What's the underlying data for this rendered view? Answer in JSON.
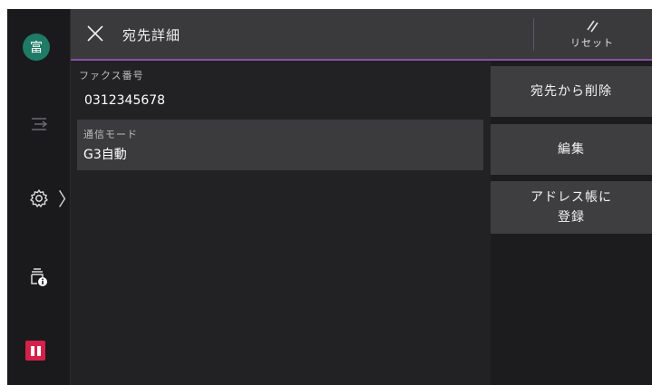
{
  "sidebar": {
    "avatar_text": "富",
    "items": [
      {
        "icon": "transfer-icon"
      },
      {
        "icon": "settings-gear-icon"
      },
      {
        "icon": "machine-info-icon"
      },
      {
        "icon": "pause-icon"
      }
    ],
    "pause_color": "#d5204a"
  },
  "header": {
    "title": "宛先詳細",
    "reset_label": "リセット",
    "accent_color": "#8c4ea6"
  },
  "details": {
    "fax_label": "ファクス番号",
    "fax_number": "0312345678",
    "mode_label": "通信モード",
    "mode_value": "G3自動"
  },
  "actions": {
    "delete_label": "宛先から削除",
    "edit_label": "編集",
    "register_label_line1": "アドレス帳に",
    "register_label_line2": "登録"
  }
}
